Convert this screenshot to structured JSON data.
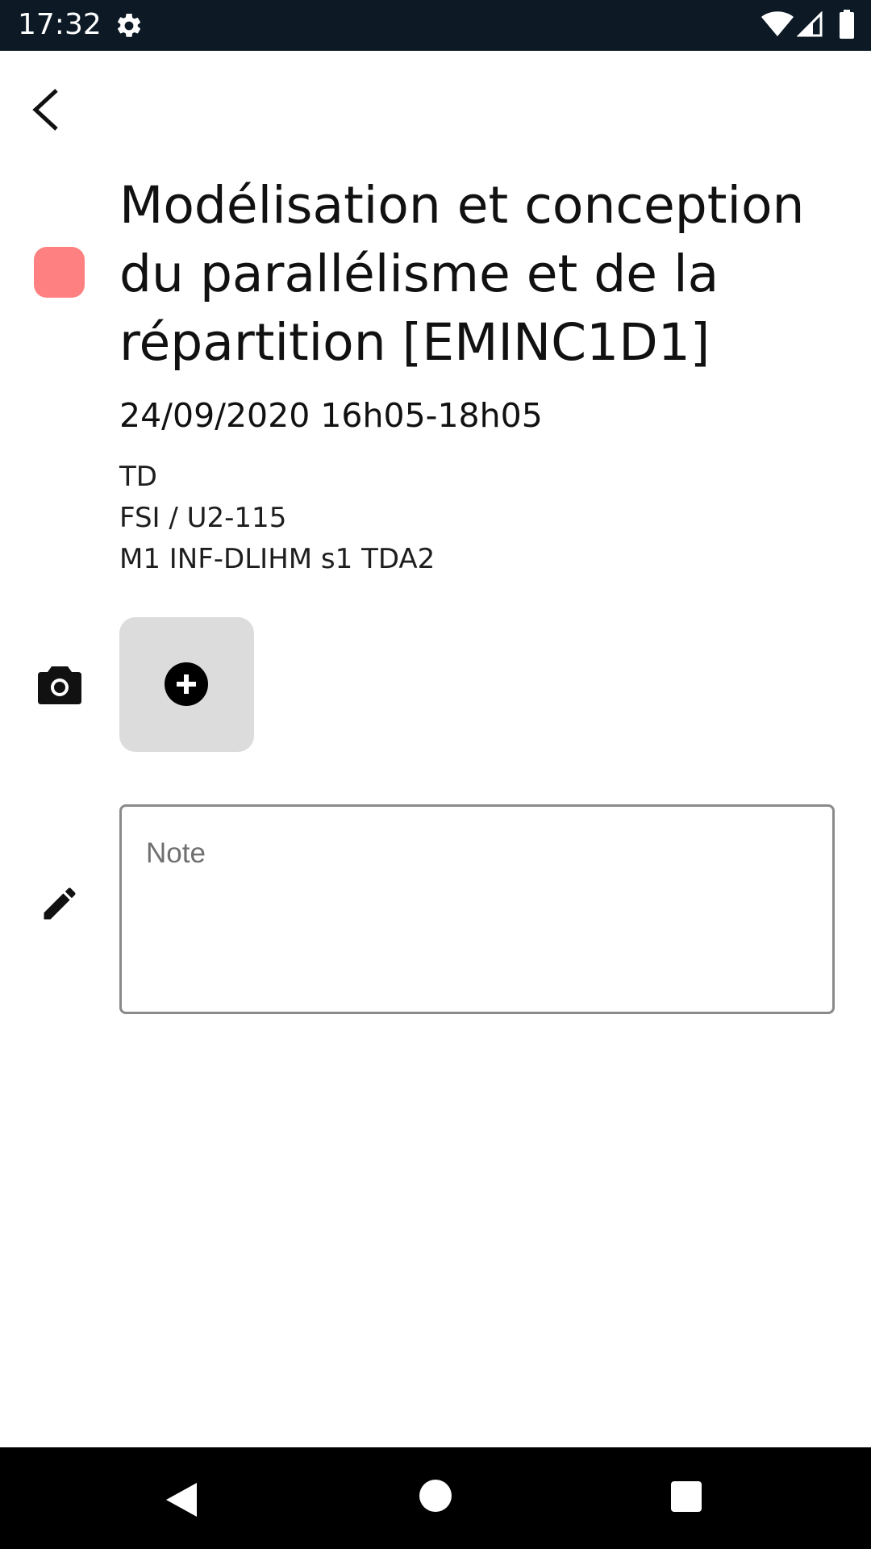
{
  "status_bar": {
    "time": "17:32",
    "icons": [
      "gear-icon",
      "wifi-icon",
      "signal-icon",
      "battery-icon"
    ]
  },
  "toolbar": {
    "back_icon": "chevron-left-icon"
  },
  "event": {
    "color": "#ff8080",
    "title": "Modélisation et conception du parallélisme et de la répartition [EMINC1D1]",
    "datetime": "24/09/2020 16h05-18h05",
    "details": [
      "TD",
      "FSI / U2-115",
      "M1 INF-DLIHM s1 TDA2"
    ]
  },
  "photos": {
    "section_icon": "camera-icon",
    "add_icon": "plus-circle-icon"
  },
  "note": {
    "section_icon": "pencil-icon",
    "placeholder": "Note",
    "value": ""
  },
  "nav_bar": {
    "icons": [
      "nav-back-icon",
      "nav-home-icon",
      "nav-recents-icon"
    ]
  }
}
